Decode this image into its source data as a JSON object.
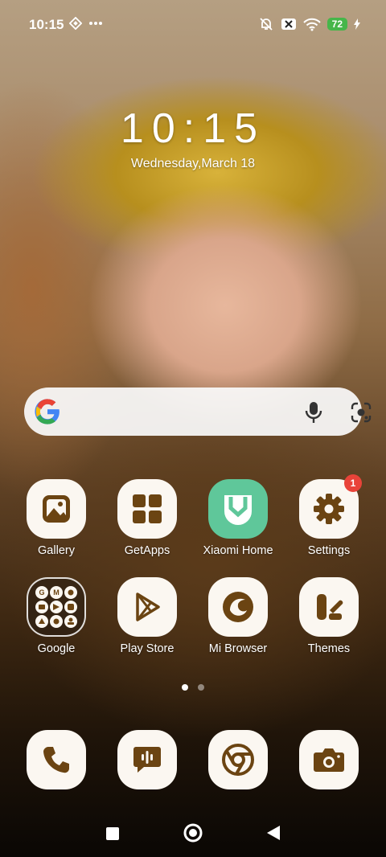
{
  "status_bar": {
    "time": "10:15",
    "battery": "72"
  },
  "lockclock": {
    "time": "10:15",
    "date": "Wednesday,March 18"
  },
  "search": {
    "logo": "google-g-icon",
    "mic": "mic-icon",
    "lens": "lens-icon"
  },
  "apps_row1": [
    {
      "label": "Gallery",
      "icon": "gallery-icon"
    },
    {
      "label": "GetApps",
      "icon": "getapps-icon"
    },
    {
      "label": "Xiaomi Home",
      "icon": "xiaomi-home-icon"
    },
    {
      "label": "Settings",
      "icon": "gear-icon",
      "badge": "1"
    }
  ],
  "apps_row2": [
    {
      "label": "Google",
      "icon": "google-folder-icon"
    },
    {
      "label": "Play Store",
      "icon": "play-store-icon"
    },
    {
      "label": "Mi Browser",
      "icon": "mi-browser-icon"
    },
    {
      "label": "Themes",
      "icon": "themes-icon"
    }
  ],
  "dock": [
    {
      "icon": "phone-icon"
    },
    {
      "icon": "messages-icon"
    },
    {
      "icon": "chrome-icon"
    },
    {
      "icon": "camera-icon"
    }
  ],
  "page_indicator": {
    "pages": 2,
    "current": 1
  },
  "colors": {
    "icon_tint": "#6b4412",
    "icon_bg": "#fbf7f1",
    "xiaomi_home_bg": "#5fc79a",
    "badge": "#e94339",
    "battery": "#46b64a"
  }
}
